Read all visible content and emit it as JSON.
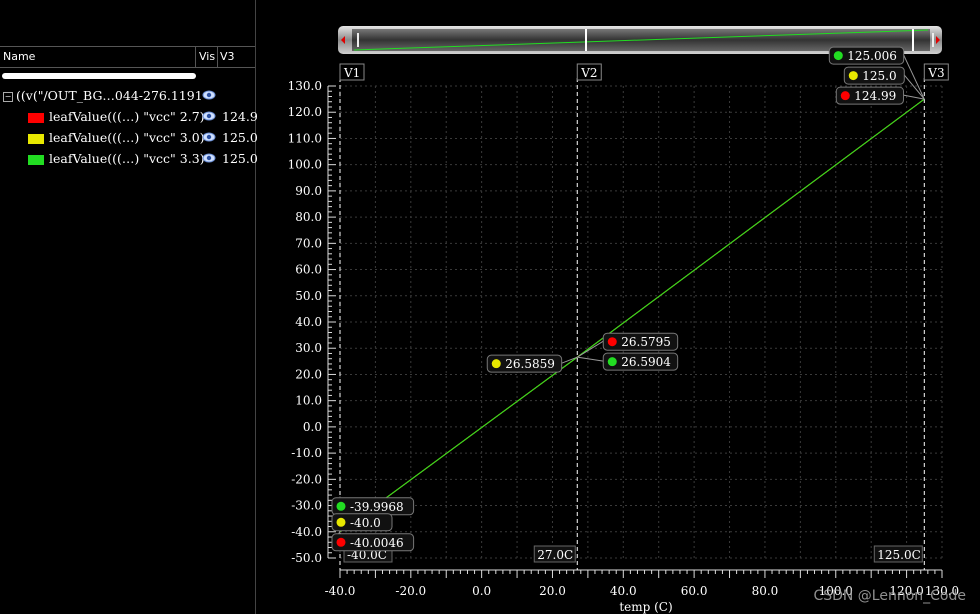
{
  "sidebar": {
    "columns": {
      "name": "Name",
      "vis": "Vis",
      "v3": "V3"
    },
    "group": {
      "label": "((v(\"/OUT_BG…044-276.1191",
      "expander": "−"
    },
    "items": [
      {
        "label": "leafValue(((…) \"vcc\" 2.7)",
        "v3": "124.9",
        "color": "#ff0000"
      },
      {
        "label": "leafValue(((…) \"vcc\" 3.0)",
        "v3": "125.0",
        "color": "#e8e800"
      },
      {
        "label": "leafValue(((…) \"vcc\" 3.3)",
        "v3": "125.0",
        "color": "#22dd22"
      }
    ],
    "icon": "eye-icon"
  },
  "chart_data": {
    "type": "line",
    "xlabel": "temp (C)",
    "ylabel": "",
    "xlim": [
      -40,
      130
    ],
    "ylim": [
      -50,
      130
    ],
    "xticks": [
      "-40.0",
      "-20.0",
      "0.0",
      "20.0",
      "40.0",
      "60.0",
      "80.0",
      "100.0",
      "120.0",
      "130.0"
    ],
    "yticks": [
      "130.0",
      "120.0",
      "110.0",
      "100.0",
      "90.0",
      "80.0",
      "70.0",
      "60.0",
      "50.0",
      "40.0",
      "30.0",
      "20.0",
      "10.0",
      "0.0",
      "-10.0",
      "-20.0",
      "-30.0",
      "-40.0",
      "-50.0"
    ],
    "series": [
      {
        "color": "#ff0000",
        "x": [
          -40,
          27,
          125
        ],
        "y": [
          -40.0046,
          26.5795,
          124.99
        ]
      },
      {
        "color": "#e8e800",
        "x": [
          -40,
          27,
          125
        ],
        "y": [
          -40.0,
          26.5859,
          125.0
        ]
      },
      {
        "color": "#22dd22",
        "x": [
          -40,
          27,
          125
        ],
        "y": [
          -39.9968,
          26.5904,
          125.006
        ]
      }
    ],
    "grid": true,
    "markers": [
      {
        "name": "V1",
        "x": -40,
        "label": "-40.0C"
      },
      {
        "name": "V2",
        "x": 27,
        "label": "27.0C"
      },
      {
        "name": "V3",
        "x": 125,
        "label": "125.0C"
      }
    ],
    "annotations": [
      {
        "marker": "V1",
        "series": 2,
        "text": "-39.9968"
      },
      {
        "marker": "V1",
        "series": 1,
        "text": "-40.0"
      },
      {
        "marker": "V1",
        "series": 0,
        "text": "-40.0046"
      },
      {
        "marker": "V2",
        "series": 0,
        "text": "26.5795"
      },
      {
        "marker": "V2",
        "series": 2,
        "text": "26.5904"
      },
      {
        "marker": "V2",
        "series": 1,
        "text": "26.5859"
      },
      {
        "marker": "V3",
        "series": 2,
        "text": "125.006"
      },
      {
        "marker": "V3",
        "series": 1,
        "text": "125.0"
      },
      {
        "marker": "V3",
        "series": 0,
        "text": "124.99"
      }
    ]
  },
  "watermark": "CSDN @Lennon_Code"
}
